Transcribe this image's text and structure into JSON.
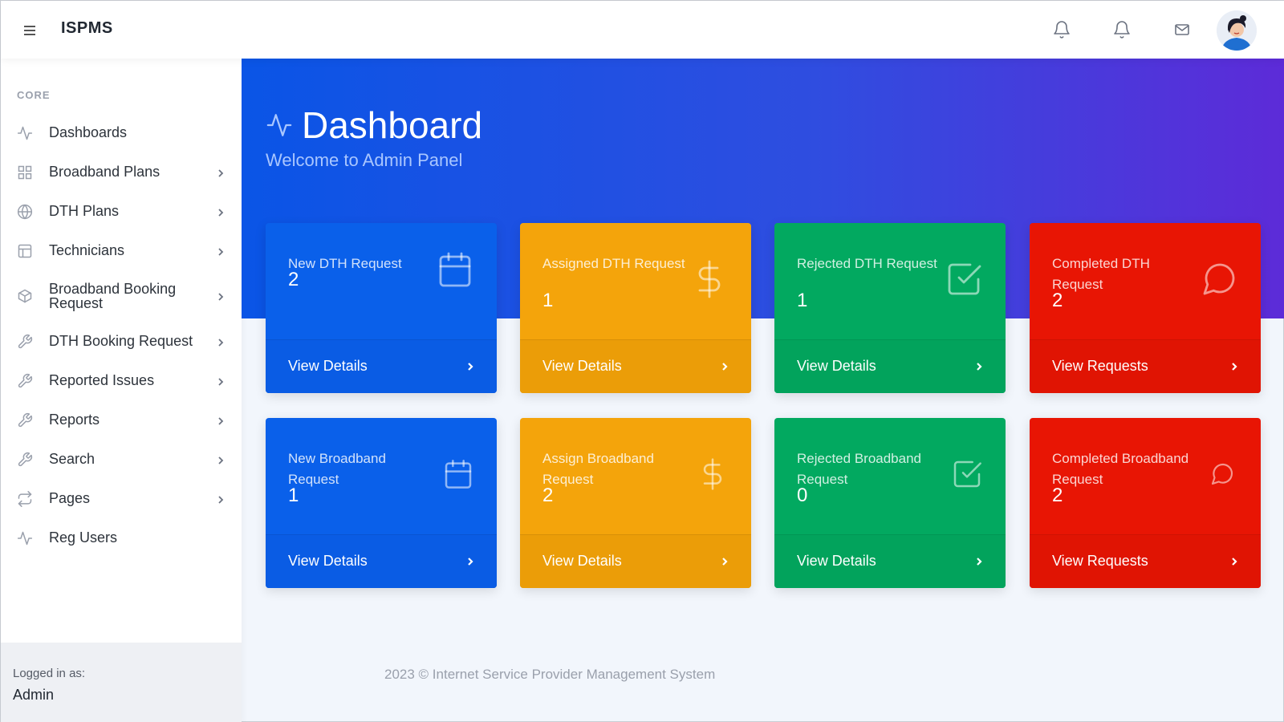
{
  "topbar": {
    "brand": "ISPMS",
    "icons": [
      "menu-icon",
      "bell-icon",
      "bell-icon",
      "mail-icon"
    ],
    "avatar": "user-avatar"
  },
  "sidebar": {
    "heading": "CORE",
    "items": [
      {
        "label": "Dashboards",
        "icon": "activity-icon",
        "chevron": false
      },
      {
        "label": "Broadband Plans",
        "icon": "grid-icon",
        "chevron": true
      },
      {
        "label": "DTH Plans",
        "icon": "globe-icon",
        "chevron": true
      },
      {
        "label": "Technicians",
        "icon": "layout-icon",
        "chevron": true
      },
      {
        "label": "Broadband Booking Request",
        "icon": "package-icon",
        "chevron": true
      },
      {
        "label": "DTH Booking Request",
        "icon": "tool-icon",
        "chevron": true
      },
      {
        "label": "Reported Issues",
        "icon": "tool-icon",
        "chevron": true
      },
      {
        "label": "Reports",
        "icon": "tool-icon",
        "chevron": true
      },
      {
        "label": "Search",
        "icon": "tool-icon",
        "chevron": true
      },
      {
        "label": "Pages",
        "icon": "repeat-icon",
        "chevron": true
      },
      {
        "label": "Reg Users",
        "icon": "activity-icon",
        "chevron": false
      }
    ],
    "footer": {
      "label": "Logged in as:",
      "user": "Admin"
    }
  },
  "header": {
    "title": "Dashboard",
    "subtitle": "Welcome to Admin Panel"
  },
  "cards": [
    {
      "title": "New DTH Request",
      "value": "2",
      "link": "View Details",
      "icon": "calendar-icon",
      "color": "#0a60ea"
    },
    {
      "title": "Assigned DTH Request",
      "value": "1",
      "link": "View Details",
      "icon": "dollar-icon",
      "color": "#f4a40b"
    },
    {
      "title": "Rejected DTH Request",
      "value": "1",
      "link": "View Details",
      "icon": "check-square-icon",
      "color": "#02a960"
    },
    {
      "title": "Completed DTH Request",
      "value": "2",
      "link": "View Requests",
      "icon": "message-circle-icon",
      "color": "#e81504"
    },
    {
      "title": "New Broadband Request",
      "value": "1",
      "link": "View Details",
      "icon": "calendar-icon",
      "color": "#0a60ea"
    },
    {
      "title": "Assign Broadband Request",
      "value": "2",
      "link": "View Details",
      "icon": "dollar-icon",
      "color": "#f4a40b"
    },
    {
      "title": "Rejected Broadband Request",
      "value": "0",
      "link": "View Details",
      "icon": "check-square-icon",
      "color": "#02a960"
    },
    {
      "title": "Completed Broadband Request",
      "value": "2",
      "link": "View Requests",
      "icon": "message-circle-icon",
      "color": "#e81504"
    }
  ],
  "footer": {
    "text": "2023 © Internet Service Provider Management System"
  }
}
